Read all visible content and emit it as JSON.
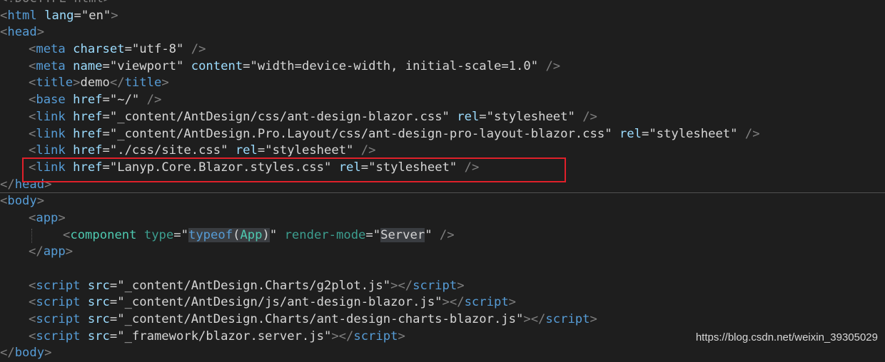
{
  "colors": {
    "background": "#1e1e1e",
    "tag": "#569cd6",
    "attribute": "#9cdcfe",
    "string": "#d6d6d6",
    "punctuation": "#808080",
    "blazor_component": "#4ec9b0",
    "highlight_box": "#e0202a"
  },
  "code": {
    "line_doctype": "<!DOCTYPE html>",
    "html": {
      "tag": "html",
      "attr": "lang",
      "value": "\"en\""
    },
    "head_open": "head",
    "meta_charset": {
      "tag": "meta",
      "attr": "charset",
      "value": "\"utf-8\""
    },
    "meta_viewport": {
      "tag": "meta",
      "attr1": "name",
      "value1": "\"viewport\"",
      "attr2": "content",
      "value2": "\"width=device-width, initial-scale=1.0\""
    },
    "title": {
      "tag": "title",
      "text": "demo"
    },
    "base": {
      "tag": "base",
      "attr": "href",
      "value": "\"~/\""
    },
    "links": [
      {
        "tag": "link",
        "attr1": "href",
        "value1": "\"_content/AntDesign/css/ant-design-blazor.css\"",
        "attr2": "rel",
        "value2": "\"stylesheet\""
      },
      {
        "tag": "link",
        "attr1": "href",
        "value1": "\"_content/AntDesign.Pro.Layout/css/ant-design-pro-layout-blazor.css\"",
        "attr2": "rel",
        "value2": "\"stylesheet\""
      },
      {
        "tag": "link",
        "attr1": "href",
        "value1": "\"./css/site.css\"",
        "attr2": "rel",
        "value2": "\"stylesheet\""
      },
      {
        "tag": "link",
        "attr1": "href",
        "value1": "\"Lanyp.Core.Blazor.styles.css\"",
        "attr2": "rel",
        "value2": "\"stylesheet\""
      }
    ],
    "head_close": "head",
    "body_open": "body",
    "app_tag": "app",
    "component": {
      "tag": "component",
      "attr1": "type",
      "typeof_kw": "typeof",
      "typeof_arg": "App",
      "attr2": "render-mode",
      "mode_value": "Server"
    },
    "scripts": [
      {
        "tag": "script",
        "attr": "src",
        "value": "\"_content/AntDesign.Charts/g2plot.js\""
      },
      {
        "tag": "script",
        "attr": "src",
        "value": "\"_content/AntDesign/js/ant-design-blazor.js\""
      },
      {
        "tag": "script",
        "attr": "src",
        "value": "\"_content/AntDesign.Charts/ant-design-charts-blazor.js\""
      },
      {
        "tag": "script",
        "attr": "src",
        "value": "\"_framework/blazor.server.js\""
      }
    ],
    "body_close": "body"
  },
  "watermark": "https://blog.csdn.net/weixin_39305029"
}
